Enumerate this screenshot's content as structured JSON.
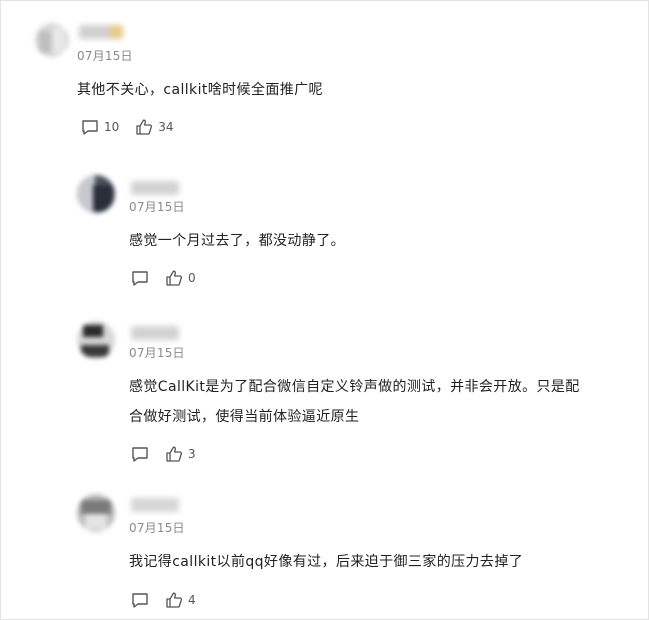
{
  "colors": {
    "date": "#8a8a8a",
    "text": "#222222",
    "icon": "#555555"
  },
  "icons": {
    "reply": "comment-bubble-icon",
    "like": "thumbs-up-icon"
  },
  "comments": [
    {
      "date": "07月15日",
      "text": "其他不关心，callkit啥时候全面推广呢",
      "reply_count": "10",
      "like_count": "34"
    },
    {
      "date": "07月15日",
      "text": "感觉一个月过去了，都没动静了。",
      "like_count": "0"
    },
    {
      "date": "07月15日",
      "text_lines": [
        "感觉CallKit是为了配合微信自定义铃声做的测试，并非会开放。只是配",
        "合做好测试，使得当前体验逼近原生"
      ],
      "like_count": "3"
    },
    {
      "date": "07月15日",
      "text": "我记得callkit以前qq好像有过，后来迫于御三家的压力去掉了",
      "like_count": "4"
    }
  ]
}
